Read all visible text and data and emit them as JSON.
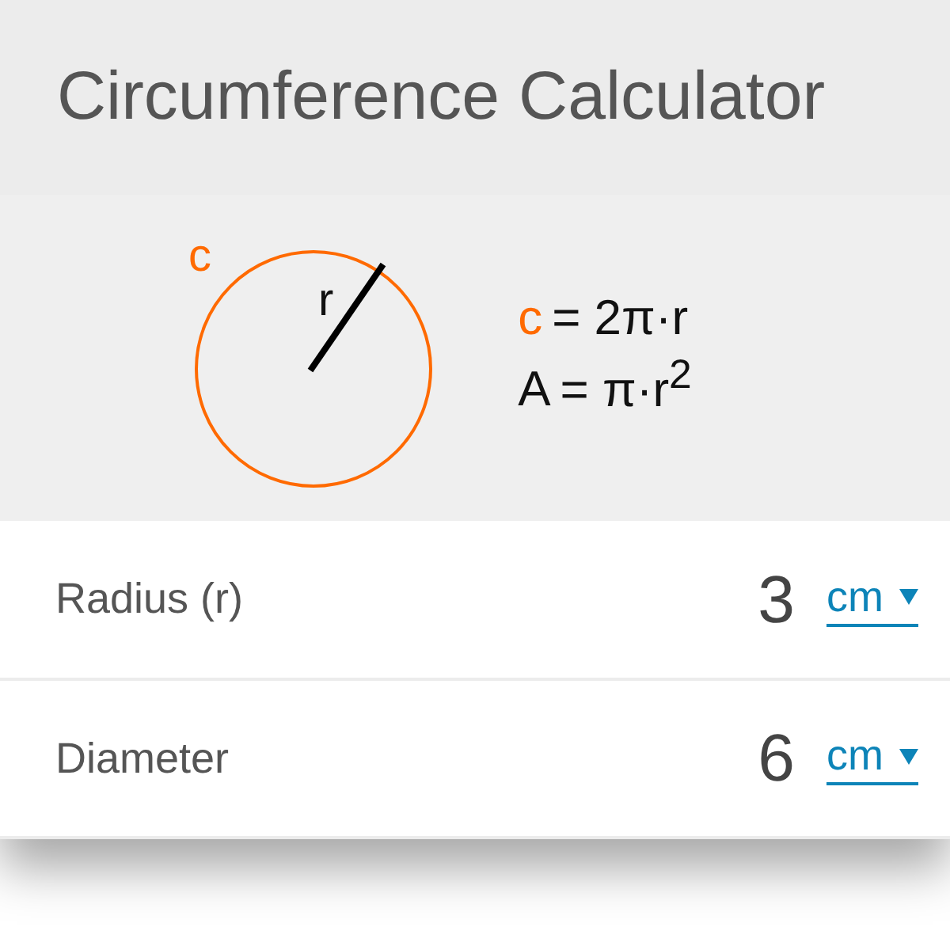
{
  "title": "Circumference Calculator",
  "diagram": {
    "circumference_label": "c",
    "radius_label": "r"
  },
  "formulas": [
    {
      "symbol": "c",
      "color": "#ff6a00",
      "expression": "= 2π·r"
    },
    {
      "symbol": "A",
      "color": "#111111",
      "expression": "= π·r$^{2}$"
    }
  ],
  "fields": [
    {
      "label": "Radius (r)",
      "value": "3",
      "unit": "cm"
    },
    {
      "label": "Diameter",
      "value": "6",
      "unit": "cm"
    }
  ]
}
